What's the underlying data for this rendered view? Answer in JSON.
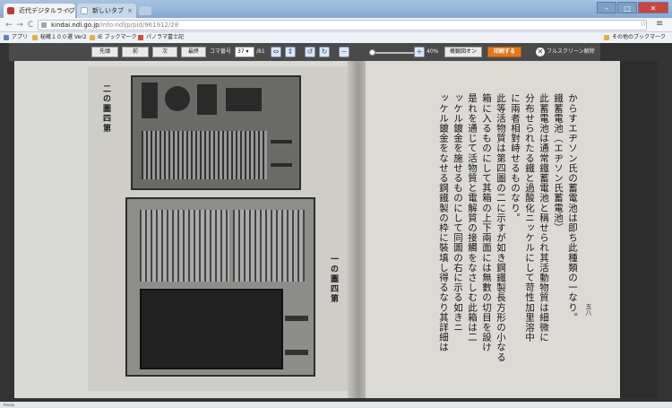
{
  "browser": {
    "tabs": [
      {
        "title": "近代デジタルライブラリ -"
      },
      {
        "title": "新しいタブ"
      }
    ],
    "address": {
      "host": "kindai.ndl.go.jp",
      "path": "/info:ndljp/pid/961912/28"
    },
    "window_controls": {
      "minimize": "–",
      "maximize": "□",
      "close": "✕"
    },
    "nav": {
      "back": "←",
      "forward": "→",
      "reload": "C"
    },
    "bookmarks": [
      {
        "label": "アプリ",
        "icon": "apps-icon"
      },
      {
        "label": "秘蔵１００選 Ver2",
        "icon": "bookmark-icon"
      },
      {
        "label": "IE ブックマーク",
        "icon": "folder-icon"
      },
      {
        "label": "パノラマ富士記",
        "icon": "bookmark-icon"
      }
    ],
    "other_bookmarks": "その他のブックマーク"
  },
  "viewer": {
    "buttons": {
      "first": "先頭",
      "prev": "前",
      "next": "次",
      "last": "最終"
    },
    "frame_label": "コマ番号",
    "frame_value": "37",
    "frame_total": "/81",
    "zoom_percent": "40%",
    "zoom_level": 0.05,
    "overview_button": "概観図オン",
    "print_button": "印刷する",
    "fullscreen_exit": "フルスクリーン解除"
  },
  "book": {
    "right_page_number": "五八",
    "caption_left_top": "二の圖四第",
    "caption_left_bottom": "一の圖四第",
    "columns": [
      "からすエヂソン氏の蓄電池は即ち此種類の一なり。",
      "鐵蓄電池（エヂソン氏蓄電池）",
      "此蓄電池は通常鐵蓄電池と稱せられ其活動物質は細微に",
      "分布せられたる鐵と過酸化ニッケルにして苛性加里溶中",
      "に兩者相對峙せるものなり。",
      "此等活物質は第四圖の二に示すが如き鋼鐵製長方形の小なる",
      "箱に入るものにして其箱の上下兩面には無數の切目を設け",
      "是れを通じて活物質と電解質の接觸をなさしむ此箱は二",
      "ッケル鍍金を施せるものにして同圖の右に示る如きニ",
      "ッケル鍍金をなせる鋼鐵製の枠に裝填し得るなり其詳細は"
    ]
  },
  "status": {
    "text": "Ready"
  }
}
